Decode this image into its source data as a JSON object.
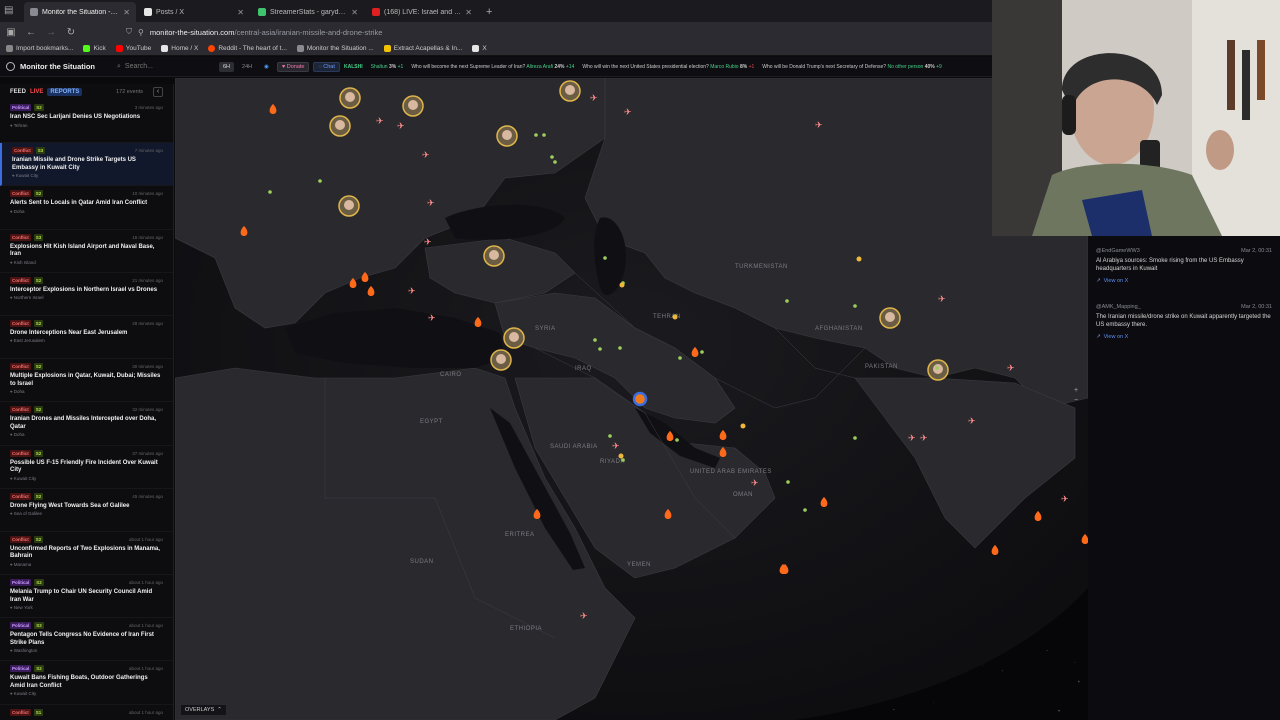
{
  "browser": {
    "tabs": [
      {
        "title": "Monitor the Situation - Live Gl",
        "active": true,
        "color": "#8a8a92"
      },
      {
        "title": "Posts / X",
        "active": false,
        "color": "#e6e6e6"
      },
      {
        "title": "StreamerStats - garydavid Strea",
        "active": false,
        "color": "#3fc36f"
      },
      {
        "title": "(168) LIVE: Israel and US Attack",
        "active": false,
        "color": "#e02020"
      }
    ],
    "new_tab": "+",
    "url_host": "monitor-the-situation.com",
    "url_path": "/central-asia/iranian-missile-and-drone-strike",
    "bookmarks": [
      {
        "label": "Import bookmarks...",
        "color": "#888"
      },
      {
        "label": "Kick",
        "color": "#53fc18"
      },
      {
        "label": "YouTube",
        "color": "#ff0000"
      },
      {
        "label": "Home / X",
        "color": "#e6e6e6"
      },
      {
        "label": "Reddit - The heart of t...",
        "color": "#ff4500"
      },
      {
        "label": "Monitor the Situation ...",
        "color": "#8a8a92"
      },
      {
        "label": "Extract Acapellas & In...",
        "color": "#f2c200"
      },
      {
        "label": "X",
        "color": "#e6e6e6"
      }
    ]
  },
  "app": {
    "title": "Monitor the Situation",
    "search_placeholder": "Search...",
    "range_6h": "6H",
    "range_24h": "24H",
    "donate": "Donate",
    "chat": "Chat",
    "ticker_brand": "KALSHI",
    "ticker": [
      {
        "label": "Shaltun",
        "pct": "3%",
        "chg": "+1"
      },
      {
        "q": "Who will become the next Supreme Leader of Iran?",
        "label": "Alireza Arafi",
        "pct": "24%",
        "chg": "+14"
      },
      {
        "q": "Who will win the next United States presidential election?",
        "label": "Marco Rubio",
        "pct": "8%",
        "chg": "+1"
      },
      {
        "q": "Who will be Donald Trump's next Secretary of Defense?",
        "label": "No other person",
        "pct": "40%",
        "chg": "+9"
      }
    ]
  },
  "feed": {
    "label": "FEED",
    "live": "LIVE",
    "reports": "REPORTS",
    "count": "172 events",
    "items": [
      {
        "cat": "Political",
        "score": "S2",
        "time": "3 minutes ago",
        "title": "Iran NSC Sec Larijani Denies US Negotiations",
        "loc": "Tehran"
      },
      {
        "cat": "Conflict",
        "score": "S3",
        "time": "7 minutes ago",
        "title": "Iranian Missile and Drone Strike Targets US Embassy in Kuwait City",
        "loc": "Kuwait City",
        "selected": true
      },
      {
        "cat": "Conflict",
        "score": "S2",
        "time": "10 minutes ago",
        "title": "Alerts Sent to Locals in Qatar Amid Iran Conflict",
        "loc": "Doha"
      },
      {
        "cat": "Conflict",
        "score": "S3",
        "time": "16 minutes ago",
        "title": "Explosions Hit Kish Island Airport and Naval Base, Iran",
        "loc": "Kish Island"
      },
      {
        "cat": "Conflict",
        "score": "S2",
        "time": "21 minutes ago",
        "title": "Interceptor Explosions in Northern Israel vs Drones",
        "loc": "Northern Israel"
      },
      {
        "cat": "Conflict",
        "score": "S2",
        "time": "28 minutes ago",
        "title": "Drone Interceptions Near East Jerusalem",
        "loc": "East Jerusalem"
      },
      {
        "cat": "Conflict",
        "score": "S2",
        "time": "30 minutes ago",
        "title": "Multiple Explosions in Qatar, Kuwait, Dubai; Missiles to Israel",
        "loc": "Doha"
      },
      {
        "cat": "Conflict",
        "score": "S2",
        "time": "32 minutes ago",
        "title": "Iranian Drones and Missiles Intercepted over Doha, Qatar",
        "loc": "Doha"
      },
      {
        "cat": "Conflict",
        "score": "S2",
        "time": "37 minutes ago",
        "title": "Possible US F-15 Friendly Fire Incident Over Kuwait City",
        "loc": "Kuwait City"
      },
      {
        "cat": "Conflict",
        "score": "S2",
        "time": "45 minutes ago",
        "title": "Drone Flying West Towards Sea of Galilee",
        "loc": "Sea of Galilee"
      },
      {
        "cat": "Conflict",
        "score": "S2",
        "time": "about 1 hour ago",
        "title": "Unconfirmed Reports of Two Explosions in Manama, Bahrain",
        "loc": "Manama"
      },
      {
        "cat": "Political",
        "score": "S2",
        "time": "about 1 hour ago",
        "title": "Melania Trump to Chair UN Security Council Amid Iran War",
        "loc": "New York"
      },
      {
        "cat": "Political",
        "score": "S2",
        "time": "about 1 hour ago",
        "title": "Pentagon Tells Congress No Evidence of Iran First Strike Plans",
        "loc": "Washington"
      },
      {
        "cat": "Political",
        "score": "S2",
        "time": "about 1 hour ago",
        "title": "Kuwait Bans Fishing Boats, Outdoor Gatherings Amid Iran Conflict",
        "loc": "Kuwait City"
      },
      {
        "cat": "Conflict",
        "score": "S1",
        "time": "about 1 hour ago",
        "title": "",
        "loc": ""
      }
    ]
  },
  "map": {
    "overlays": "OVERLAYS",
    "zoom_in": "+",
    "zoom_out": "−",
    "labels": [
      "SYRIA",
      "IRAQ",
      "EGYPT",
      "SAUDI ARABIA",
      "YEMEN",
      "SUDAN",
      "ERITREA",
      "ETHIOPIA",
      "OMAN",
      "PAKISTAN",
      "AFGHANISTAN",
      "TURKMENISTAN",
      "TEHRAN",
      "CAIRO",
      "RIYADH",
      "UNITED ARAB EMIRATES"
    ]
  },
  "xposts": [
    {
      "handle": "@EndGameWW3",
      "date": "Mar 2, 00:31",
      "text": "Al Arabiya sources: Smoke rising from the US Embassy headquarters in Kuwait",
      "link": "View on X"
    },
    {
      "handle": "@AMK_Mapping_",
      "date": "Mar 2, 00:31",
      "text": "The Iranian missile/drone strike on Kuwait apparently targeted the US embassy there.",
      "link": "View on X"
    }
  ],
  "colors": {
    "accent": "#3b6de0",
    "conflict": "#ff7070",
    "political": "#c99cff",
    "fire": "#ff6a1a"
  }
}
